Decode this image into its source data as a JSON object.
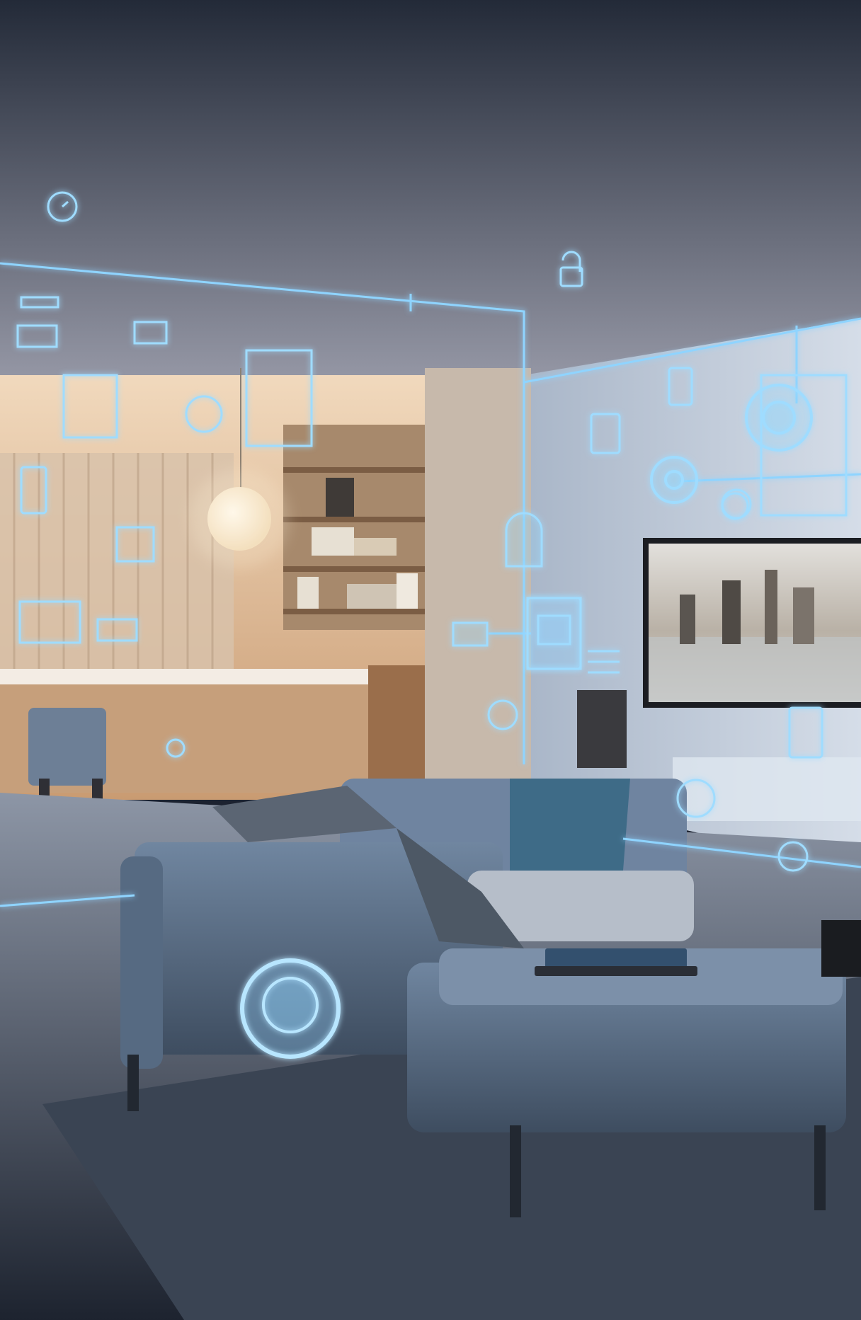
{
  "scene": {
    "description_tag": "",
    "colors": {
      "neon": "#8fd4ff",
      "neon_core": "#e6f6ff",
      "ceiling_top": "#262d3c",
      "ceiling_bottom": "#8b8f9c",
      "wall_right": "#b9c6d8",
      "warm_room": "#e9c9a6",
      "sofa": "#5d7289",
      "sofa_dark": "#3f5064",
      "floor": "#2a3140",
      "rug": "#3c4654"
    },
    "icons": [
      "thermostat-icon",
      "lock-icon",
      "camera-icon",
      "speaker-icon",
      "light-bulb-icon",
      "router-icon",
      "smart-plug-icon",
      "tv-icon",
      "security-sensor-icon",
      "smart-hub-icon"
    ]
  }
}
